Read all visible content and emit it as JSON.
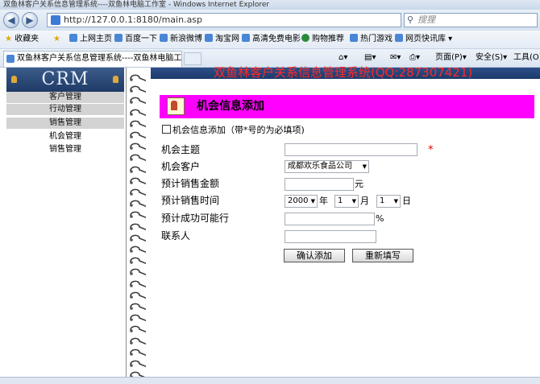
{
  "browser": {
    "window_title": "双鱼林客户关系信息管理系统----双鱼林电脑工作室 - Windows Internet Explorer",
    "address": "http://127.0.0.1:8180/main.asp",
    "search_placeholder": "搜狸",
    "favorites_label": "收藏夹",
    "favorites": [
      "上网主页",
      "百度一下",
      "新浪微博",
      "淘宝网",
      "高清免费电影",
      "购物推荐",
      "热门游戏",
      "网页快讯库"
    ],
    "tab_title": "双鱼林客户关系信息管理系统----双鱼林电脑工作...",
    "toolbar": {
      "page": "页面(P)",
      "safety": "安全(S)",
      "tools": "工具(O)"
    }
  },
  "sidebar": {
    "logo": "CRM",
    "menu": [
      {
        "label": "客户管理"
      },
      {
        "label": "行动管理"
      },
      {
        "label": "销售管理"
      }
    ],
    "subitems": [
      "机会管理",
      "销售管理"
    ]
  },
  "header": {
    "system_title": "双鱼林客户关系信息管理系统(QQ:287307421)"
  },
  "form": {
    "title": "机会信息添加",
    "hint": "机会信息添加（带*号的为必填项)",
    "fields": {
      "subject": {
        "label": "机会主题",
        "value": "",
        "required_mark": "*"
      },
      "customer": {
        "label": "机会客户",
        "value": "成都欢乐食品公司"
      },
      "amount": {
        "label": "预计销售金额",
        "value": "",
        "unit": "元"
      },
      "date": {
        "label": "预计销售时间",
        "year": "2000",
        "year_unit": "年",
        "month": "1",
        "month_unit": "月",
        "day": "1",
        "day_unit": "日"
      },
      "probability": {
        "label": "预计成功可能行",
        "value": "",
        "unit": "%"
      },
      "contact": {
        "label": "联系人",
        "value": ""
      }
    },
    "buttons": {
      "submit": "确认添加",
      "reset": "重新填写"
    }
  }
}
